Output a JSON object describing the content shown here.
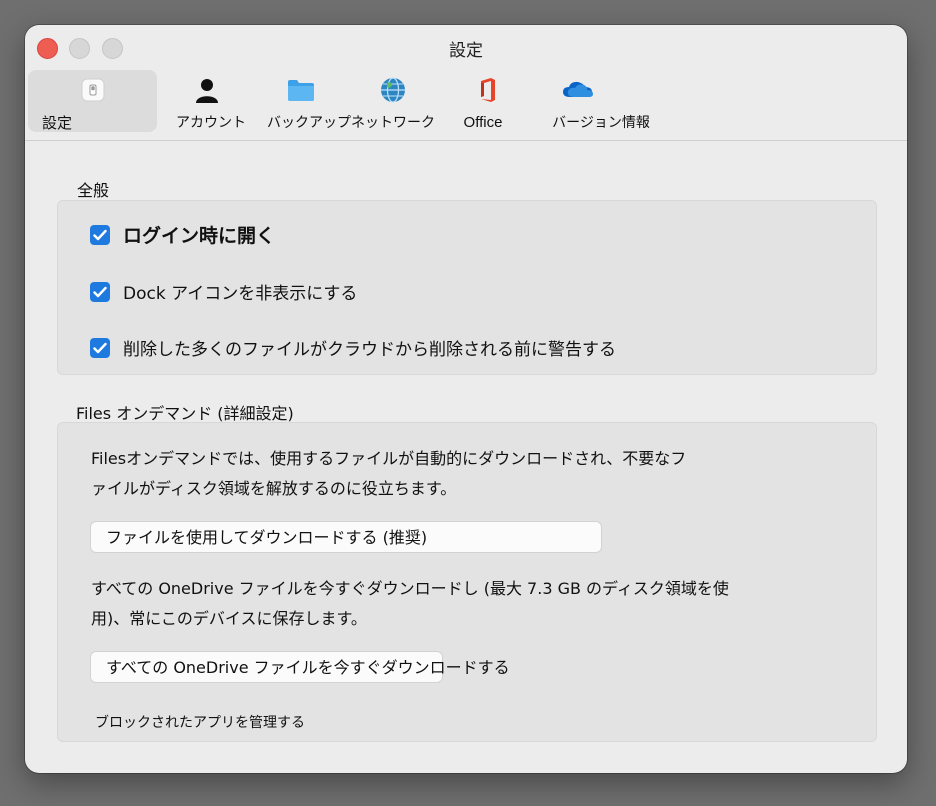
{
  "window": {
    "title": "設定"
  },
  "toolbar": {
    "items": [
      {
        "label": "設定",
        "icon": "settings-switch-icon",
        "active": true
      },
      {
        "label": "アカウント",
        "icon": "person-icon"
      },
      {
        "label": "バックアップ",
        "icon": "folder-icon"
      },
      {
        "label": "ネットワーク",
        "icon": "globe-icon"
      },
      {
        "label": "Office",
        "icon": "office-icon"
      },
      {
        "label": "バージョン情報",
        "icon": "onedrive-cloud-icon"
      }
    ]
  },
  "general": {
    "title": "全般",
    "options": [
      {
        "label": "ログイン時に開く",
        "checked": true
      },
      {
        "label": "Dock アイコンを非表示にする",
        "checked": true
      },
      {
        "label": "削除した多くのファイルがクラウドから削除される前に警告する",
        "checked": true
      }
    ]
  },
  "files_on_demand": {
    "title": "Files オンデマンド (詳細設定)",
    "description_line1": "Filesオンデマンドでは、使用するファイルが自動的にダウンロードされ、不要なフ",
    "description_line2": "ァイルがディスク領域を解放するのに役立ちます。",
    "download_on_use_button": "ファイルを使用してダウンロードする (推奨)",
    "download_all_description_line1": "すべての OneDrive ファイルを今すぐダウンロードし (最大 7.3 GB のディスク領域を使",
    "download_all_description_line2": "用)、常にこのデバイスに保存します。",
    "download_all_button": "すべての OneDrive ファイルを今すぐダウンロードする",
    "manage_blocked_apps": "ブロックされたアプリを管理する"
  },
  "colors": {
    "accent": "#1f7ae0",
    "close_button": "#ee5d52",
    "window_bg": "#ececec",
    "group_bg": "#e3e3e3"
  }
}
